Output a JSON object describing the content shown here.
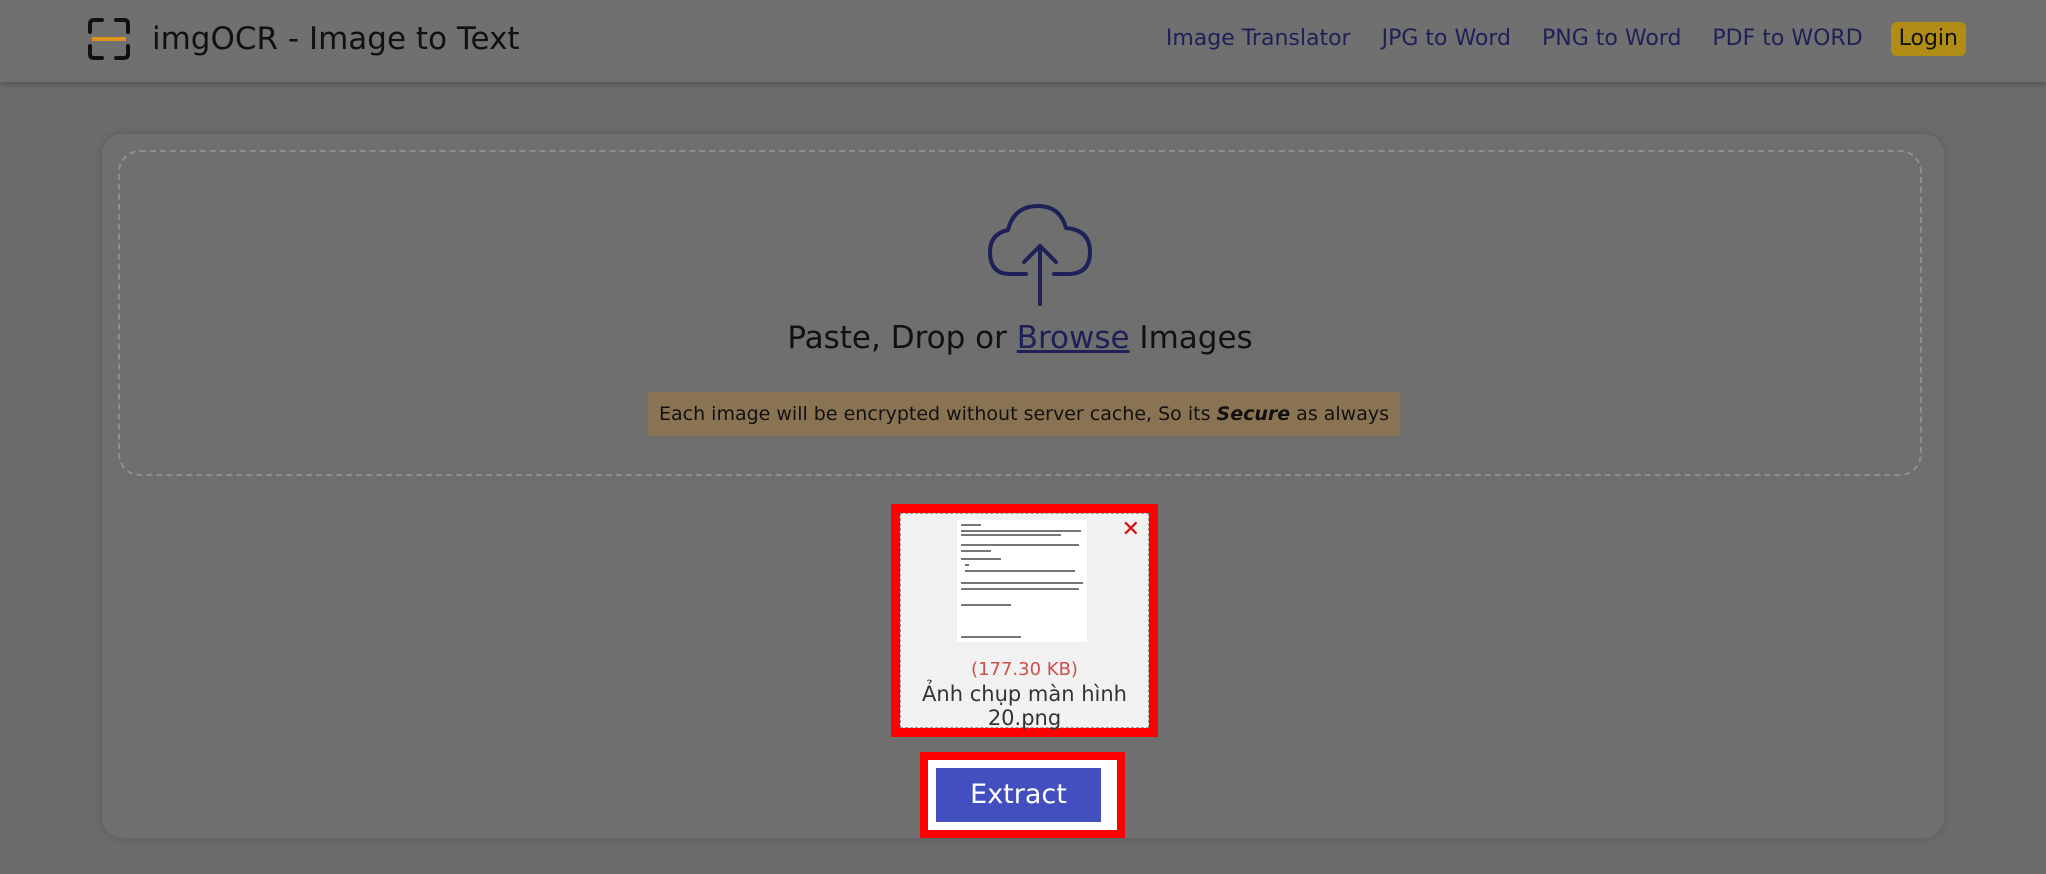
{
  "header": {
    "brand": "imgOCR - Image to Text",
    "nav": [
      {
        "label": "Image Translator"
      },
      {
        "label": "JPG to Word"
      },
      {
        "label": "PNG to Word"
      },
      {
        "label": "PDF to WORD"
      }
    ],
    "login_label": "Login"
  },
  "dropzone": {
    "icon": "cloud-upload-icon",
    "text_before": "Paste, Drop or ",
    "browse_label": "Browse",
    "text_after": " Images",
    "notice_before": "Each image will be encrypted without server cache, So its ",
    "notice_bold": "Secure",
    "notice_after": " as always"
  },
  "file": {
    "size": "(177.30 KB)",
    "name": "Ảnh chụp màn hình 20.png"
  },
  "actions": {
    "extract_label": "Extract"
  },
  "colors": {
    "accent": "#434fbf",
    "highlight": "#ff0000",
    "login": "#b28d16",
    "logo_orange": "#e0931c"
  }
}
